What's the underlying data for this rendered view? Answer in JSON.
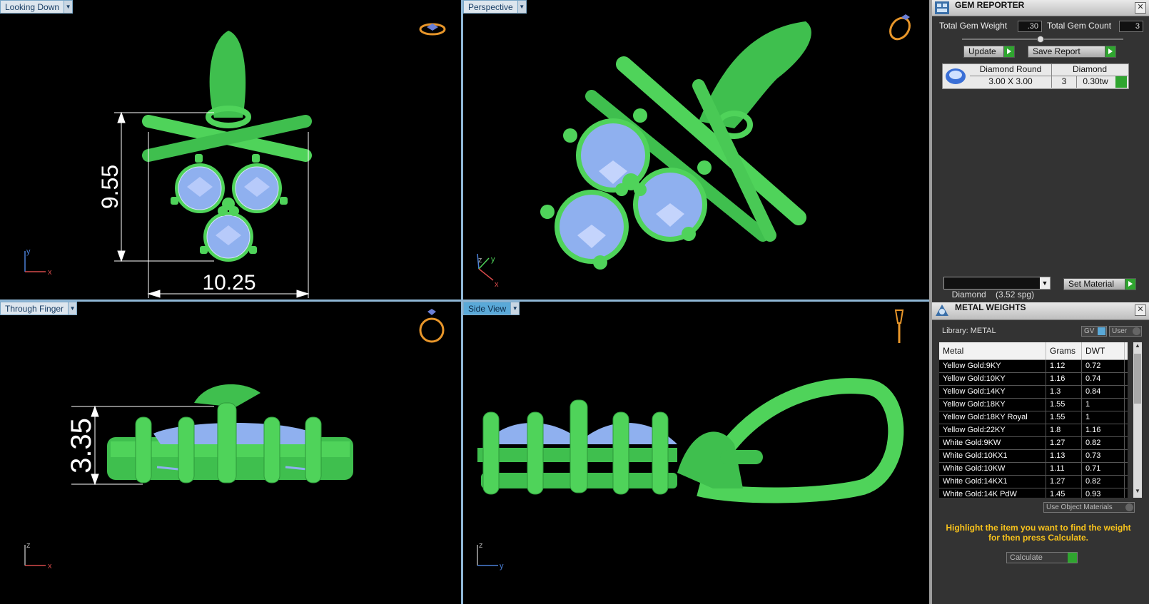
{
  "viewports": {
    "top_left": {
      "label": "Looking Down",
      "dim_vertical": "9.55",
      "dim_horizontal": "10.25",
      "axis_v": "y",
      "axis_h": "x"
    },
    "top_right": {
      "label": "Perspective",
      "axis_v": "y",
      "axis_z": "z",
      "axis_h": "x"
    },
    "bottom_left": {
      "label": "Through Finger",
      "dim_vertical": "3.35",
      "axis_v": "z",
      "axis_h": "x"
    },
    "bottom_right": {
      "label": "Side View",
      "axis_v": "z",
      "axis_h": "y"
    }
  },
  "gem_reporter": {
    "title": "GEM REPORTER",
    "total_weight_label": "Total Gem Weight",
    "total_weight_value": ".30",
    "total_count_label": "Total Gem Count",
    "total_count_value": "3",
    "update_label": "Update",
    "save_report_label": "Save Report",
    "gem": {
      "shape": "Diamond Round",
      "size": "3.00 X 3.00",
      "type": "Diamond",
      "count": "3",
      "weight": "0.30tw"
    },
    "material_select": "Diamond    (3.52 spg)",
    "set_material_label": "Set Material"
  },
  "metal_weights": {
    "title": "METAL WEIGHTS",
    "library_label": "Library: METAL",
    "gv_label": "GV",
    "user_label": "User",
    "columns": [
      "Metal",
      "Grams",
      "DWT"
    ],
    "rows": [
      [
        "Yellow Gold:9KY",
        "1.12",
        "0.72"
      ],
      [
        "Yellow Gold:10KY",
        "1.16",
        "0.74"
      ],
      [
        "Yellow Gold:14KY",
        "1.3",
        "0.84"
      ],
      [
        "Yellow Gold:18KY",
        "1.55",
        "1"
      ],
      [
        "Yellow Gold:18KY Royal",
        "1.55",
        "1"
      ],
      [
        "Yellow Gold:22KY",
        "1.8",
        "1.16"
      ],
      [
        "White Gold:9KW",
        "1.27",
        "0.82"
      ],
      [
        "White Gold:10KX1",
        "1.13",
        "0.73"
      ],
      [
        "White Gold:10KW",
        "1.11",
        "0.71"
      ],
      [
        "White Gold:14KX1",
        "1.27",
        "0.82"
      ],
      [
        "White Gold:14K PdW",
        "1.45",
        "0.93"
      ]
    ],
    "use_object_materials_label": "Use Object Materials",
    "hint": "Highlight the item you want to find the weight for then press Calculate.",
    "calculate_label": "Calculate"
  },
  "colors": {
    "metal": "#4fd35a",
    "gem": "#8fb0ef",
    "accent": "#5aa9d8",
    "hint": "#f7c21c"
  }
}
